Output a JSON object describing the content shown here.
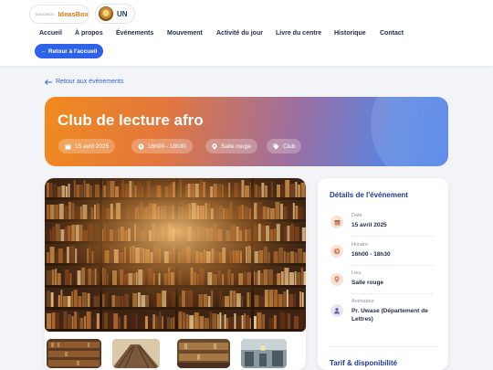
{
  "header": {
    "logo1_small": "IDEASBOX",
    "logo1_brand": "IdeasBox",
    "logo2_text": "UN"
  },
  "nav": {
    "items": [
      "Accueil",
      "À propos",
      "Événements",
      "Mouvement",
      "Activité du jour",
      "Livre du centre",
      "Historique",
      "Contact"
    ]
  },
  "back_home": "← Retour à l'accueil",
  "back_events": "Retour aux événements",
  "event": {
    "title": "Club de lecture afro",
    "chips": {
      "date": "15 avril 2025",
      "time": "16h00 - 18h30",
      "place": "Salle rouge",
      "tag": "Club"
    }
  },
  "details": {
    "heading": "Détails de l'événement",
    "rows": [
      {
        "label": "Date",
        "value": "15 avril 2025",
        "icon": "calendar-icon"
      },
      {
        "label": "Horaire",
        "value": "16h00 - 18h30",
        "icon": "clock-icon"
      },
      {
        "label": "Lieu",
        "value": "Salle rouge",
        "icon": "location-icon"
      },
      {
        "label": "Animateur",
        "value": "Pr. Uwase (Département de Lettres)",
        "icon": "person-icon"
      }
    ],
    "tarif_heading": "Tarif & disponibilité"
  },
  "colors": {
    "accent": "#2f62e6",
    "orange": "#f08a1e",
    "heading_blue": "#1f3b8f"
  }
}
